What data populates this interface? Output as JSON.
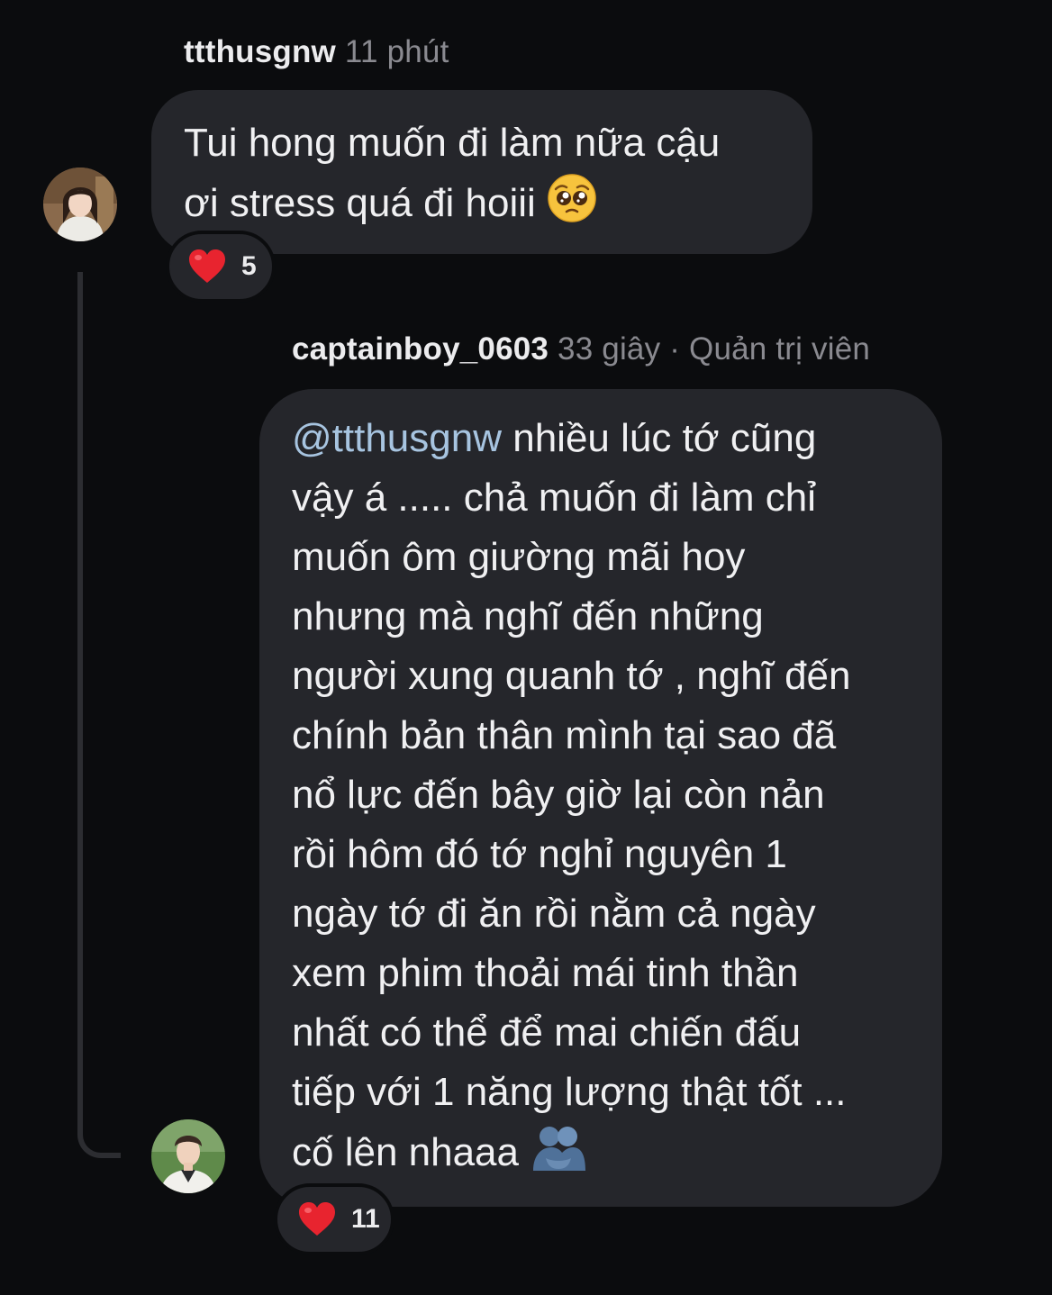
{
  "comment1": {
    "username": "ttthusgnw",
    "time": "11 phút",
    "lines": [
      "Tui hong muốn đi làm nữa cậu",
      "ơi stress quá đi hoiii"
    ],
    "emoji": "pleading-face-emoji",
    "reaction": {
      "icon": "heart",
      "count": "5"
    }
  },
  "reply": {
    "username": "captainboy_0603",
    "time": "33 giây",
    "separator": "·",
    "role": "Quản trị viên",
    "mention": "@ttthusgnw",
    "first_line_rest": " nhiều lúc tớ cũng",
    "lines": [
      "vậy á ..... chả muốn đi làm chỉ",
      "muốn ôm giường mãi hoy",
      "nhưng mà nghĩ đến những",
      "người xung quanh tớ , nghĩ đến",
      "chính bản thân mình tại sao đã",
      "nổ lực đến bây giờ lại còn nản",
      "rồi hôm đó tớ nghỉ nguyên 1",
      "ngày tớ đi ăn rồi nằm cả ngày",
      "xem phim thoải mái tinh thần",
      "nhất có thể để mai chiến đấu",
      "tiếp với 1 năng lượng thật tốt ..."
    ],
    "last_line": "cố lên nhaaa",
    "emoji": "people-hugging-emoji",
    "reaction": {
      "icon": "heart",
      "count": "11"
    }
  },
  "colors": {
    "background": "#0b0c0e",
    "bubble": "#25262b",
    "mention": "#a7c4e0",
    "heart": "#e8242f",
    "meta": "#8a8a90"
  }
}
